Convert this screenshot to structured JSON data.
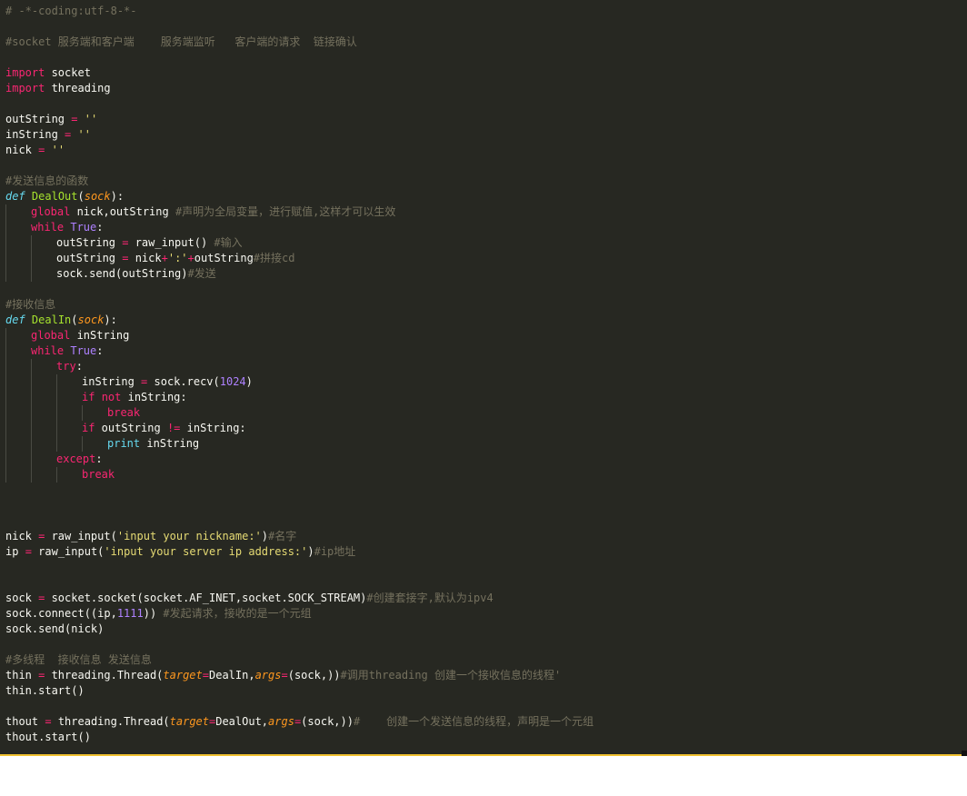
{
  "editor": {
    "theme": "monokai",
    "colors": {
      "background": "#272822",
      "comment": "#75715e",
      "keyword": "#f92672",
      "builtin": "#66d9ef",
      "function": "#a6e22e",
      "parameter": "#fd971f",
      "string": "#e6db74",
      "number": "#ae81ff",
      "text": "#f8f8f2",
      "bottom_rule": "#f0c030"
    },
    "lines": [
      {
        "indent": 0,
        "tokens": [
          {
            "t": "comment",
            "v": "# -*-coding:utf-8-*-"
          }
        ]
      },
      {
        "indent": 0,
        "tokens": []
      },
      {
        "indent": 0,
        "tokens": [
          {
            "t": "comment",
            "v": "#socket 服务端和客户端    服务端监听   客户端的请求  链接确认"
          }
        ]
      },
      {
        "indent": 0,
        "tokens": []
      },
      {
        "indent": 0,
        "tokens": [
          {
            "t": "keyword",
            "v": "import"
          },
          {
            "t": "plain",
            "v": " socket"
          }
        ]
      },
      {
        "indent": 0,
        "tokens": [
          {
            "t": "keyword",
            "v": "import"
          },
          {
            "t": "plain",
            "v": " threading"
          }
        ]
      },
      {
        "indent": 0,
        "tokens": []
      },
      {
        "indent": 0,
        "tokens": [
          {
            "t": "plain",
            "v": "outString "
          },
          {
            "t": "operator",
            "v": "="
          },
          {
            "t": "plain",
            "v": " "
          },
          {
            "t": "string",
            "v": "''"
          }
        ]
      },
      {
        "indent": 0,
        "tokens": [
          {
            "t": "plain",
            "v": "inString "
          },
          {
            "t": "operator",
            "v": "="
          },
          {
            "t": "plain",
            "v": " "
          },
          {
            "t": "string",
            "v": "''"
          }
        ]
      },
      {
        "indent": 0,
        "tokens": [
          {
            "t": "plain",
            "v": "nick "
          },
          {
            "t": "operator",
            "v": "="
          },
          {
            "t": "plain",
            "v": " "
          },
          {
            "t": "string",
            "v": "''"
          }
        ]
      },
      {
        "indent": 0,
        "tokens": []
      },
      {
        "indent": 0,
        "tokens": [
          {
            "t": "comment",
            "v": "#发送信息的函数"
          }
        ]
      },
      {
        "indent": 0,
        "tokens": [
          {
            "t": "defkw",
            "v": "def"
          },
          {
            "t": "plain",
            "v": " "
          },
          {
            "t": "fname",
            "v": "DealOut"
          },
          {
            "t": "plain",
            "v": "("
          },
          {
            "t": "param",
            "v": "sock"
          },
          {
            "t": "plain",
            "v": "):"
          }
        ]
      },
      {
        "indent": 1,
        "tokens": [
          {
            "t": "keyword",
            "v": "global"
          },
          {
            "t": "plain",
            "v": " nick,outString "
          },
          {
            "t": "comment",
            "v": "#声明为全局变量，进行赋值,这样才可以生效"
          }
        ]
      },
      {
        "indent": 1,
        "tokens": [
          {
            "t": "keyword",
            "v": "while"
          },
          {
            "t": "plain",
            "v": " "
          },
          {
            "t": "const",
            "v": "True"
          },
          {
            "t": "plain",
            "v": ":"
          }
        ]
      },
      {
        "indent": 2,
        "tokens": [
          {
            "t": "plain",
            "v": "outString "
          },
          {
            "t": "operator",
            "v": "="
          },
          {
            "t": "plain",
            "v": " raw_input() "
          },
          {
            "t": "comment",
            "v": "#输入"
          }
        ]
      },
      {
        "indent": 2,
        "tokens": [
          {
            "t": "plain",
            "v": "outString "
          },
          {
            "t": "operator",
            "v": "="
          },
          {
            "t": "plain",
            "v": " nick"
          },
          {
            "t": "operator",
            "v": "+"
          },
          {
            "t": "string",
            "v": "':'"
          },
          {
            "t": "operator",
            "v": "+"
          },
          {
            "t": "plain",
            "v": "outString"
          },
          {
            "t": "comment",
            "v": "#拼接cd"
          }
        ]
      },
      {
        "indent": 2,
        "tokens": [
          {
            "t": "plain",
            "v": "sock.send(outString)"
          },
          {
            "t": "comment",
            "v": "#发送"
          }
        ]
      },
      {
        "indent": 0,
        "tokens": []
      },
      {
        "indent": 0,
        "tokens": [
          {
            "t": "comment",
            "v": "#接收信息"
          }
        ]
      },
      {
        "indent": 0,
        "tokens": [
          {
            "t": "defkw",
            "v": "def"
          },
          {
            "t": "plain",
            "v": " "
          },
          {
            "t": "fname",
            "v": "DealIn"
          },
          {
            "t": "plain",
            "v": "("
          },
          {
            "t": "param",
            "v": "sock"
          },
          {
            "t": "plain",
            "v": "):"
          }
        ]
      },
      {
        "indent": 1,
        "tokens": [
          {
            "t": "keyword",
            "v": "global"
          },
          {
            "t": "plain",
            "v": " inString"
          }
        ]
      },
      {
        "indent": 1,
        "tokens": [
          {
            "t": "keyword",
            "v": "while"
          },
          {
            "t": "plain",
            "v": " "
          },
          {
            "t": "const",
            "v": "True"
          },
          {
            "t": "plain",
            "v": ":"
          }
        ]
      },
      {
        "indent": 2,
        "tokens": [
          {
            "t": "keyword",
            "v": "try"
          },
          {
            "t": "plain",
            "v": ":"
          }
        ]
      },
      {
        "indent": 3,
        "tokens": [
          {
            "t": "plain",
            "v": "inString "
          },
          {
            "t": "operator",
            "v": "="
          },
          {
            "t": "plain",
            "v": " sock.recv("
          },
          {
            "t": "number",
            "v": "1024"
          },
          {
            "t": "plain",
            "v": ")"
          }
        ]
      },
      {
        "indent": 3,
        "tokens": [
          {
            "t": "keyword",
            "v": "if"
          },
          {
            "t": "plain",
            "v": " "
          },
          {
            "t": "keyword",
            "v": "not"
          },
          {
            "t": "plain",
            "v": " inString:"
          }
        ]
      },
      {
        "indent": 4,
        "tokens": [
          {
            "t": "keyword",
            "v": "break"
          }
        ]
      },
      {
        "indent": 3,
        "tokens": [
          {
            "t": "keyword",
            "v": "if"
          },
          {
            "t": "plain",
            "v": " outString "
          },
          {
            "t": "operator",
            "v": "!="
          },
          {
            "t": "plain",
            "v": " inString:"
          }
        ]
      },
      {
        "indent": 4,
        "tokens": [
          {
            "t": "builtin",
            "v": "print"
          },
          {
            "t": "plain",
            "v": " inString"
          }
        ]
      },
      {
        "indent": 2,
        "tokens": [
          {
            "t": "keyword",
            "v": "except"
          },
          {
            "t": "plain",
            "v": ":"
          }
        ]
      },
      {
        "indent": 3,
        "tokens": [
          {
            "t": "keyword",
            "v": "break"
          }
        ]
      },
      {
        "indent": 0,
        "tokens": []
      },
      {
        "indent": 0,
        "tokens": []
      },
      {
        "indent": 0,
        "tokens": []
      },
      {
        "indent": 0,
        "tokens": [
          {
            "t": "plain",
            "v": "nick "
          },
          {
            "t": "operator",
            "v": "="
          },
          {
            "t": "plain",
            "v": " raw_input("
          },
          {
            "t": "string",
            "v": "'input your nickname:'"
          },
          {
            "t": "plain",
            "v": ")"
          },
          {
            "t": "comment",
            "v": "#名字"
          }
        ]
      },
      {
        "indent": 0,
        "tokens": [
          {
            "t": "plain",
            "v": "ip "
          },
          {
            "t": "operator",
            "v": "="
          },
          {
            "t": "plain",
            "v": " raw_input("
          },
          {
            "t": "string",
            "v": "'input your server ip address:'"
          },
          {
            "t": "plain",
            "v": ")"
          },
          {
            "t": "comment",
            "v": "#ip地址"
          }
        ]
      },
      {
        "indent": 0,
        "tokens": []
      },
      {
        "indent": 0,
        "tokens": []
      },
      {
        "indent": 0,
        "tokens": [
          {
            "t": "plain",
            "v": "sock "
          },
          {
            "t": "operator",
            "v": "="
          },
          {
            "t": "plain",
            "v": " socket.socket(socket.AF_INET,socket.SOCK_STREAM)"
          },
          {
            "t": "comment",
            "v": "#创建套接字,默认为ipv4"
          }
        ]
      },
      {
        "indent": 0,
        "tokens": [
          {
            "t": "plain",
            "v": "sock.connect((ip,"
          },
          {
            "t": "number",
            "v": "1111"
          },
          {
            "t": "plain",
            "v": ")) "
          },
          {
            "t": "comment",
            "v": "#发起请求，接收的是一个元组"
          }
        ]
      },
      {
        "indent": 0,
        "tokens": [
          {
            "t": "plain",
            "v": "sock.send(nick)"
          }
        ]
      },
      {
        "indent": 0,
        "tokens": []
      },
      {
        "indent": 0,
        "tokens": [
          {
            "t": "comment",
            "v": "#多线程  接收信息 发送信息"
          }
        ]
      },
      {
        "indent": 0,
        "tokens": [
          {
            "t": "plain",
            "v": "thin "
          },
          {
            "t": "operator",
            "v": "="
          },
          {
            "t": "plain",
            "v": " threading.Thread("
          },
          {
            "t": "param",
            "v": "target"
          },
          {
            "t": "operator",
            "v": "="
          },
          {
            "t": "plain",
            "v": "DealIn,"
          },
          {
            "t": "param",
            "v": "args"
          },
          {
            "t": "operator",
            "v": "="
          },
          {
            "t": "plain",
            "v": "(sock,))"
          },
          {
            "t": "comment",
            "v": "#调用threading 创建一个接收信息的线程'"
          }
        ]
      },
      {
        "indent": 0,
        "tokens": [
          {
            "t": "plain",
            "v": "thin.start()"
          }
        ]
      },
      {
        "indent": 0,
        "tokens": []
      },
      {
        "indent": 0,
        "tokens": [
          {
            "t": "plain",
            "v": "thout "
          },
          {
            "t": "operator",
            "v": "="
          },
          {
            "t": "plain",
            "v": " threading.Thread("
          },
          {
            "t": "param",
            "v": "target"
          },
          {
            "t": "operator",
            "v": "="
          },
          {
            "t": "plain",
            "v": "DealOut,"
          },
          {
            "t": "param",
            "v": "args"
          },
          {
            "t": "operator",
            "v": "="
          },
          {
            "t": "plain",
            "v": "(sock,))"
          },
          {
            "t": "comment",
            "v": "#    创建一个发送信息的线程，声明是一个元组"
          }
        ]
      },
      {
        "indent": 0,
        "tokens": [
          {
            "t": "plain",
            "v": "thout.start()"
          }
        ]
      }
    ]
  }
}
